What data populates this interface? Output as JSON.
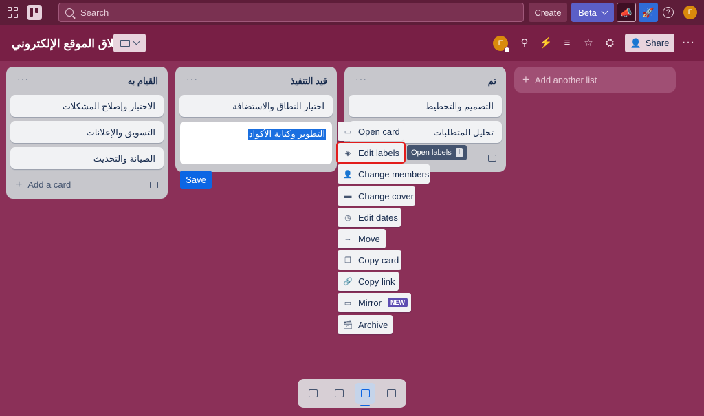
{
  "topbar": {
    "search_placeholder": "Search",
    "create_label": "Create",
    "beta_label": "Beta",
    "avatar_initial": "F",
    "help_glyph": "?"
  },
  "board": {
    "title": "إطلاق الموقع الإلكتروني",
    "share_label": "Share",
    "avatar_initial": "F"
  },
  "lists": [
    {
      "title": "القيام به",
      "cards": [
        "الاختبار وإصلاح المشكلات",
        "التسويق والإعلانات",
        "الصيانة والتحديث"
      ],
      "add_card_label": "Add a card"
    },
    {
      "title": "قيد التنفيذ",
      "cards": [
        "اختيار النطاق والاستضافة"
      ],
      "editing_text": "التطوير وكتابة الأكواد",
      "save_label": "Save"
    },
    {
      "title": "تم",
      "cards": [
        "التصميم والتخطيط",
        "تحليل المتطلبات"
      ]
    }
  ],
  "add_list_label": "Add another list",
  "quick_menu": [
    {
      "label": "Open card",
      "icon": "card-icon"
    },
    {
      "label": "Edit labels",
      "icon": "label-icon"
    },
    {
      "label": "Change members",
      "icon": "person-icon"
    },
    {
      "label": "Change cover",
      "icon": "cover-icon"
    },
    {
      "label": "Edit dates",
      "icon": "clock-icon"
    },
    {
      "label": "Move",
      "icon": "arrow-right-icon"
    },
    {
      "label": "Copy card",
      "icon": "copy-icon"
    },
    {
      "label": "Copy link",
      "icon": "link-icon"
    },
    {
      "label": "Mirror",
      "icon": "mirror-icon",
      "badge": "NEW"
    },
    {
      "label": "Archive",
      "icon": "archive-icon"
    }
  ],
  "tooltip": {
    "label": "Open labels",
    "shortcut": "l"
  },
  "colors": {
    "background": "#8b3058",
    "topbar": "#5e1d39",
    "boardbar": "#781f45",
    "primary": "#0c66e4",
    "highlight_outline": "#e21c1c"
  }
}
